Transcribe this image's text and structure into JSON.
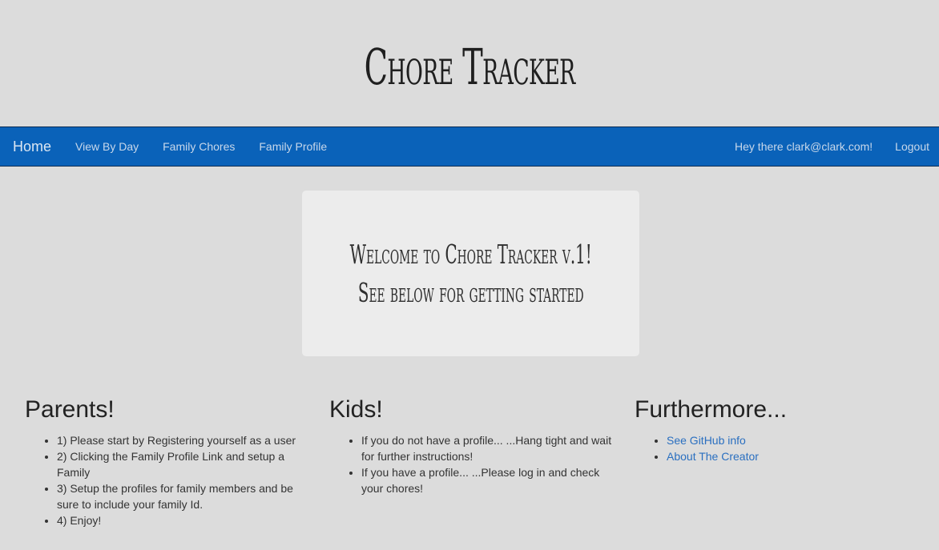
{
  "header": {
    "title": "Chore Tracker"
  },
  "navbar": {
    "brand": "Home",
    "links": [
      "View By Day",
      "Family Chores",
      "Family Profile"
    ],
    "greeting": "Hey there clark@clark.com!",
    "logout": "Logout"
  },
  "jumbotron": {
    "line1": "Welcome to Chore Tracker v.1!",
    "line2": "See below for getting started"
  },
  "parents": {
    "heading": "Parents!",
    "items": [
      "1) Please start by Registering yourself as a user",
      "2) Clicking the Family Profile Link and setup a Family",
      "3) Setup the profiles for family members and be sure to include your family Id.",
      "4) Enjoy!"
    ]
  },
  "kids": {
    "heading": "Kids!",
    "items": [
      "If you do not have a profile... ...Hang tight and wait for further instructions!",
      "If you have a profile... ...Please log in and check your chores!"
    ]
  },
  "furthermore": {
    "heading": "Furthermore...",
    "links": [
      "See GitHub info",
      "About The Creator"
    ]
  },
  "colors": {
    "navbar": "#0a62b9",
    "background": "#dcdcdc",
    "jumbotron": "#ececec",
    "link": "#2a6fc0"
  }
}
